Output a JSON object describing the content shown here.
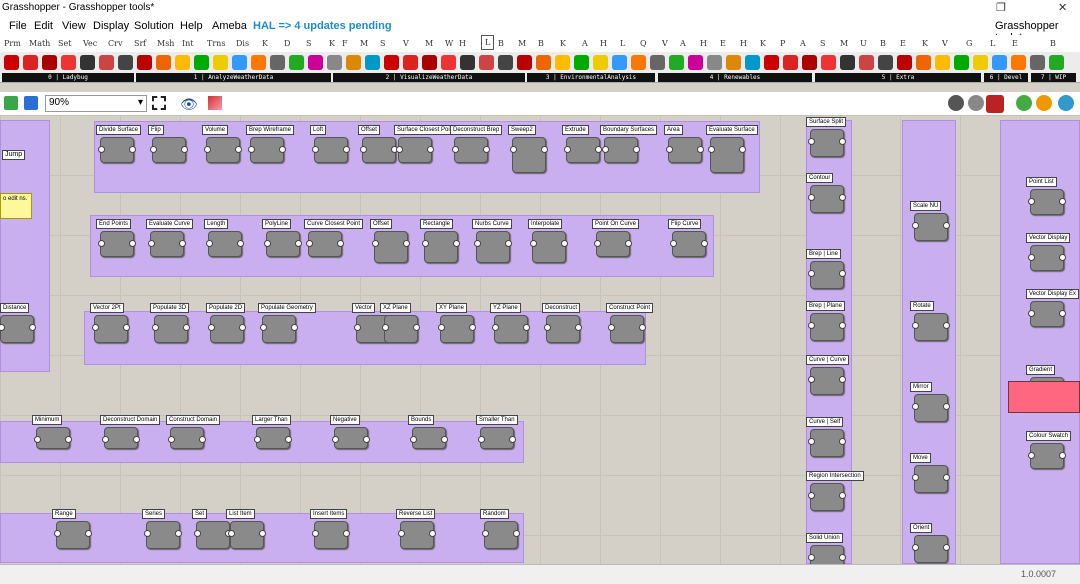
{
  "window": {
    "title": "Grasshopper - Grasshopper tools*",
    "doc_name": "Grasshopper tools*",
    "controls": [
      "❐",
      "✕"
    ]
  },
  "menu": {
    "items": [
      "File",
      "Edit",
      "View",
      "Display",
      "Solution",
      "Help",
      "Ameba"
    ],
    "hal": "HAL => 4 updates pending"
  },
  "tabs": [
    "Prm",
    "Math",
    "Set",
    "Vec",
    "Crv",
    "Srf",
    "Msh",
    "Int",
    "Trns",
    "Dis",
    "K",
    "D",
    "S",
    "K",
    "F",
    "M",
    "S",
    "V",
    "M",
    "W",
    "H",
    "L",
    "B",
    "M",
    "B",
    "K",
    "A",
    "H",
    "L",
    "Q",
    "V",
    "A",
    "H",
    "E",
    "H",
    "K",
    "P",
    "A",
    "S",
    "M",
    "U",
    "B",
    "E",
    "K",
    "V",
    "G",
    "L",
    "E",
    "B"
  ],
  "active_tab": "L",
  "ribbon_sections": [
    "0 | Ladybug",
    "1 | AnalyzeWeatherData",
    "2 | VisualizeWeatherData",
    "3 | EnvironmentalAnalysis",
    "4 | Renewables",
    "5 | Extra",
    "6 | Devel",
    "7 | WIP"
  ],
  "zoom": "90%",
  "groups": {
    "row1": [
      "Divide Surface",
      "Flip",
      "Volume",
      "Brep Wireframe",
      "Loft",
      "Offset",
      "Surface Closest Point",
      "Deconstruct Brep",
      "Sweep2",
      "Extrude",
      "Boundary Surfaces",
      "Area",
      "Evaluate Surface"
    ],
    "row2": [
      "End Points",
      "Evaluate Curve",
      "Length",
      "PolyLine",
      "Curve Closest Point",
      "Offset",
      "Rectangle",
      "Nurbs Curve",
      "Interpolate",
      "Point On Curve",
      "Flip Curve"
    ],
    "row3": [
      "Vector 2Pt",
      "Populate 3D",
      "Populate 2D",
      "Populate Geometry",
      "Vector",
      "XZ Plane",
      "XY Plane",
      "YZ Plane",
      "Deconstruct",
      "Construct Point",
      "Distance"
    ],
    "row4": [
      "Minimum",
      "Deconstruct Domain",
      "Construct Domain",
      "Larger Than",
      "Negative",
      "Bounds",
      "Smaller Than"
    ],
    "row5": [
      "Range",
      "Series",
      "Set",
      "List Item",
      "Insert Items",
      "Reverse List",
      "Random"
    ],
    "col1": [
      "Surface Split",
      "Contour",
      "Brep | Line",
      "Brep | Plane",
      "Curve | Curve",
      "Curve | Self",
      "Region Intersection",
      "Solid Union"
    ],
    "col2": [
      "Scale NU",
      "Rotate",
      "Mirror",
      "Move",
      "Orient"
    ],
    "col3": [
      "Point List",
      "Vector Display",
      "Vector Display Ex",
      "Gradient",
      "Colour Swatch"
    ]
  },
  "left_panel": {
    "jump": "Jump",
    "note": "o edit ns."
  },
  "status": {
    "version": "1.0.0007"
  }
}
